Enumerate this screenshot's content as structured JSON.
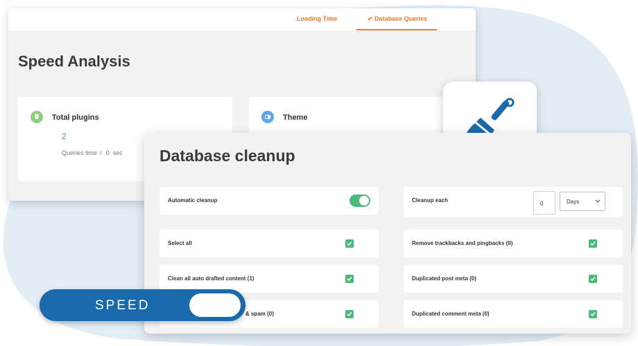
{
  "tabs": {
    "loading_time": "Loading Time",
    "database_queries": "Database Queries"
  },
  "speed_analysis": {
    "title": "Speed Analysis",
    "plugins": {
      "label": "Total plugins",
      "count": "2",
      "queries_time": "Queries time =  0  sec"
    },
    "theme": {
      "label": "Theme"
    }
  },
  "db_cleanup": {
    "title": "Database cleanup",
    "automatic_cleanup": {
      "label": "Automatic cleanup",
      "enabled": true
    },
    "cleanup_each": {
      "label": "Cleanup each",
      "value": "0",
      "unit": "Days"
    },
    "items": [
      {
        "label": "Select all",
        "checked": true
      },
      {
        "label": "Remove trackbacks and pingbacks  (0)",
        "checked": true
      },
      {
        "label": "Clean all auto drafted content  (1)",
        "checked": true
      },
      {
        "label": "Duplicated post meta  (0)",
        "checked": true
      },
      {
        "label": "& spam  (0)",
        "checked": true
      },
      {
        "label": "Duplicated comment meta  (0)",
        "checked": true
      }
    ]
  },
  "speed_toggle": {
    "label": "SPEED"
  },
  "colors": {
    "accent_orange": "#f07a2b",
    "check_green": "#4bb97a",
    "speed_blue": "#1a6aab",
    "broom_blue": "#1a6aab"
  },
  "icons": [
    "plugin-icon",
    "theme-icon",
    "broom-icon",
    "check-icon",
    "chevron-down-icon"
  ]
}
